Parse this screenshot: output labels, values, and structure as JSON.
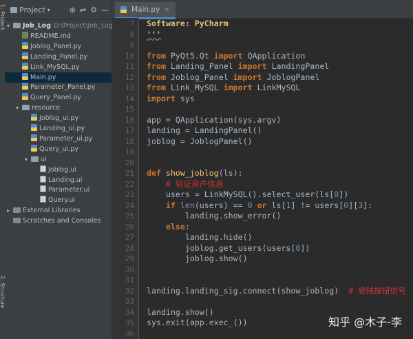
{
  "left_tabs": [
    "1: Project",
    "2: Structure"
  ],
  "project_panel": {
    "title": "Project",
    "tools": [
      "globe",
      "collapse",
      "gear",
      "minimize"
    ]
  },
  "tree": [
    {
      "depth": 0,
      "arrow": "▾",
      "icon": "folder",
      "label": "Job_Log",
      "extra": "D:\\Project\\Job_Log",
      "bold": true
    },
    {
      "depth": 1,
      "arrow": "",
      "icon": "md",
      "label": "README.md"
    },
    {
      "depth": 1,
      "arrow": "",
      "icon": "py",
      "label": "Joblog_Panel.py"
    },
    {
      "depth": 1,
      "arrow": "",
      "icon": "py",
      "label": "Landing_Panel.py"
    },
    {
      "depth": 1,
      "arrow": "",
      "icon": "py",
      "label": "Link_MySQL.py"
    },
    {
      "depth": 1,
      "arrow": "",
      "icon": "py",
      "label": "Main.py",
      "selected": true
    },
    {
      "depth": 1,
      "arrow": "",
      "icon": "py",
      "label": "Parameter_Panel.py"
    },
    {
      "depth": 1,
      "arrow": "",
      "icon": "py",
      "label": "Query_Panel.py"
    },
    {
      "depth": 1,
      "arrow": "▾",
      "icon": "folder",
      "label": "resource"
    },
    {
      "depth": 2,
      "arrow": "",
      "icon": "py",
      "label": "Joblog_ui.py"
    },
    {
      "depth": 2,
      "arrow": "",
      "icon": "py",
      "label": "Landing_ui.py"
    },
    {
      "depth": 2,
      "arrow": "",
      "icon": "py",
      "label": "Parameter_ui.py"
    },
    {
      "depth": 2,
      "arrow": "",
      "icon": "py",
      "label": "Query_ui.py"
    },
    {
      "depth": 2,
      "arrow": "▾",
      "icon": "folder",
      "label": "ui"
    },
    {
      "depth": 3,
      "arrow": "",
      "icon": "ui",
      "label": "Joblog.ui"
    },
    {
      "depth": 3,
      "arrow": "",
      "icon": "ui",
      "label": "Landing.ui"
    },
    {
      "depth": 3,
      "arrow": "",
      "icon": "ui",
      "label": "Parameter.ui"
    },
    {
      "depth": 3,
      "arrow": "",
      "icon": "ui",
      "label": "Query.ui"
    },
    {
      "depth": 0,
      "arrow": "▸",
      "icon": "lib",
      "label": "External Libraries"
    },
    {
      "depth": 0,
      "arrow": "",
      "icon": "lib",
      "label": "Scratches and Consoles"
    }
  ],
  "editor": {
    "tab_label": "Main.py",
    "line_numbers": [
      "7",
      "8",
      "9",
      "10",
      "11",
      "12",
      "13",
      "14",
      "15",
      "16",
      "17",
      "18",
      "19",
      "20",
      "21",
      "22",
      "23",
      "24",
      "25",
      "26",
      "27",
      "28",
      "29",
      "30",
      "31",
      "32",
      "33",
      "34",
      "35",
      "36"
    ]
  },
  "code_lines": [
    [
      {
        "t": "Software: PyCharm",
        "c": "str"
      }
    ],
    [
      {
        "t": "'''",
        "c": "str ul"
      }
    ],
    [],
    [
      {
        "t": "from ",
        "c": "kw"
      },
      {
        "t": "PyQt5.Qt "
      },
      {
        "t": "import ",
        "c": "kw"
      },
      {
        "t": "QApplication"
      }
    ],
    [
      {
        "t": "from ",
        "c": "kw"
      },
      {
        "t": "Landing_Panel "
      },
      {
        "t": "import ",
        "c": "kw"
      },
      {
        "t": "LandingPanel"
      }
    ],
    [
      {
        "t": "from ",
        "c": "kw"
      },
      {
        "t": "Joblog_Panel "
      },
      {
        "t": "import ",
        "c": "kw"
      },
      {
        "t": "JoblogPanel"
      }
    ],
    [
      {
        "t": "from ",
        "c": "kw"
      },
      {
        "t": "Link_MySQL "
      },
      {
        "t": "import ",
        "c": "kw"
      },
      {
        "t": "LinkMySQL"
      }
    ],
    [
      {
        "t": "import ",
        "c": "kw"
      },
      {
        "t": "sys"
      }
    ],
    [],
    [
      {
        "t": "app = QApplication(sys.argv)"
      }
    ],
    [
      {
        "t": "landing = LandingPanel()"
      }
    ],
    [
      {
        "t": "joblog = JoblogPanel()"
      }
    ],
    [],
    [],
    [
      {
        "t": "def ",
        "c": "kw"
      },
      {
        "t": "show_joblog",
        "c": "fn"
      },
      {
        "t": "(ls):"
      }
    ],
    [
      {
        "t": "    "
      },
      {
        "t": "# 验证用户信息",
        "c": "cmt"
      }
    ],
    [
      {
        "t": "    users = LinkMySQL().select_user(ls["
      },
      {
        "t": "0",
        "c": "num"
      },
      {
        "t": "])"
      }
    ],
    [
      {
        "t": "    "
      },
      {
        "t": "if ",
        "c": "kw"
      },
      {
        "t": "len",
        "c": "bi"
      },
      {
        "t": "(users) == "
      },
      {
        "t": "0",
        "c": "num"
      },
      {
        "t": " "
      },
      {
        "t": "or ",
        "c": "kw"
      },
      {
        "t": "ls["
      },
      {
        "t": "1",
        "c": "num"
      },
      {
        "t": "] != users["
      },
      {
        "t": "0",
        "c": "num"
      },
      {
        "t": "]["
      },
      {
        "t": "3",
        "c": "num"
      },
      {
        "t": "]:"
      }
    ],
    [
      {
        "t": "        landing.show_error()"
      }
    ],
    [
      {
        "t": "    "
      },
      {
        "t": "else",
        "c": "kw"
      },
      {
        "t": ":"
      }
    ],
    [
      {
        "t": "        landing.hide()"
      }
    ],
    [
      {
        "t": "        joblog.get_users(users["
      },
      {
        "t": "0",
        "c": "num"
      },
      {
        "t": "])"
      }
    ],
    [
      {
        "t": "        joblog.show()"
      }
    ],
    [],
    [],
    [
      {
        "t": "landing.landing_sig.connect(show_joblog)  "
      },
      {
        "t": "# 登陆按钮信号",
        "c": "cmt"
      }
    ],
    [],
    [
      {
        "t": "landing.show()"
      }
    ],
    [
      {
        "t": "sys.exit(app.exec_())"
      }
    ],
    []
  ],
  "watermark": "知乎 @木子-李"
}
